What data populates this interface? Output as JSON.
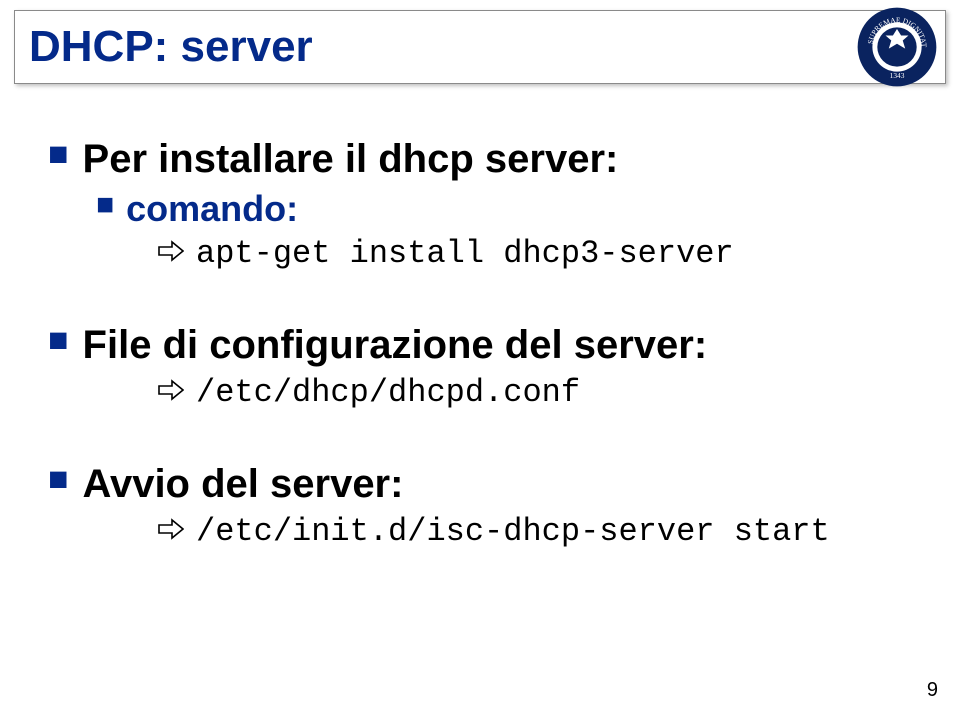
{
  "title": "DHCP: server",
  "page_number": "9",
  "bullets": {
    "b1": {
      "text": "Per installare il dhcp server:"
    },
    "b1_1": {
      "text": "comando:"
    },
    "b1_1_1": {
      "text": "apt-get install dhcp3-server"
    },
    "b2": {
      "text": "File di configurazione del server:"
    },
    "b2_1": {
      "text": "/etc/dhcp/dhcpd.conf"
    },
    "b3": {
      "text": "Avvio del server:"
    },
    "b3_1": {
      "text": "/etc/init.d/isc-dhcp-server start"
    }
  }
}
